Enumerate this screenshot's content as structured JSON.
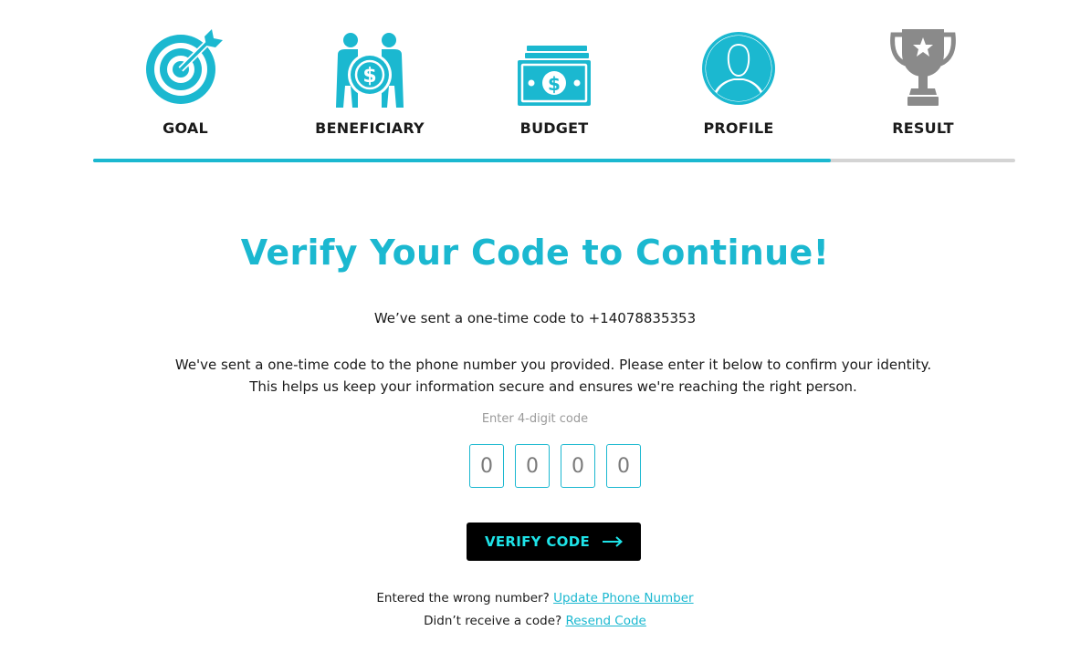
{
  "colors": {
    "accent": "#1bb8d0",
    "icon_active": "#1bb8d0",
    "icon_inactive": "#8a8a8a",
    "button_bg": "#000000",
    "button_text": "#1ee3e8",
    "progress_track": "#d4d4d4"
  },
  "steps": [
    {
      "label": "GOAL",
      "icon": "target-icon",
      "active": true
    },
    {
      "label": "BENEFICIARY",
      "icon": "beneficiary-icon",
      "active": true
    },
    {
      "label": "BUDGET",
      "icon": "money-stack-icon",
      "active": true
    },
    {
      "label": "PROFILE",
      "icon": "profile-icon",
      "active": true
    },
    {
      "label": "RESULT",
      "icon": "trophy-icon",
      "active": false
    }
  ],
  "progress": {
    "completed_steps": 4,
    "total_steps": 5
  },
  "main": {
    "title": "Verify Your Code to Continue!",
    "sent_line": "We’ve sent a one-time code to +14078835353",
    "description": "We've sent a one-time code to the phone number you provided. Please enter it below to confirm your identity. This helps us keep your information secure and ensures we're reaching the right person.",
    "code_label": "Enter 4-digit code",
    "code_placeholders": [
      "0",
      "0",
      "0",
      "0"
    ],
    "verify_button": "VERIFY CODE",
    "wrong_number_text": "Entered the wrong number?",
    "update_link": "Update Phone Number",
    "no_code_text": "Didn’t receive a code?",
    "resend_link": "Resend Code"
  }
}
